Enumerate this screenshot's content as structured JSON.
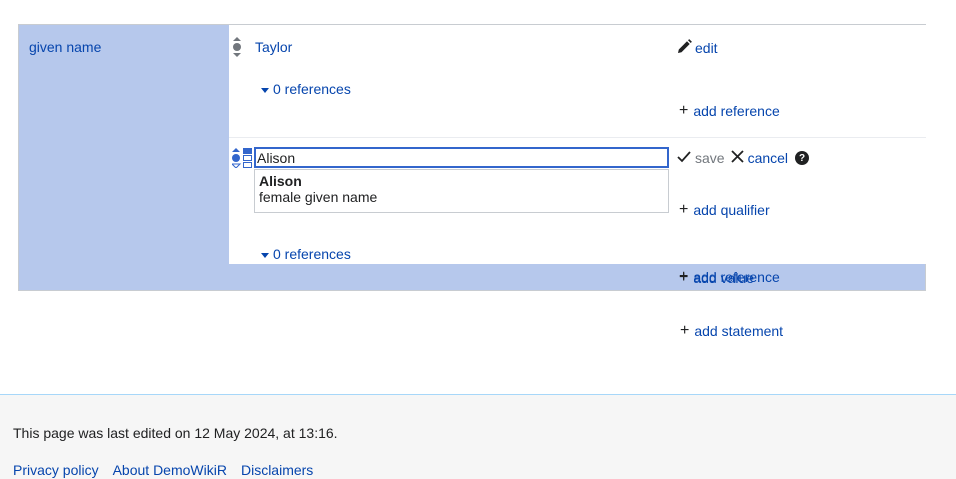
{
  "statement_group": {
    "property_label": "given name",
    "statements": [
      {
        "value": "Taylor",
        "edit_label": "edit",
        "references_label": "0 references",
        "add_reference_label": "add reference"
      }
    ],
    "editing": {
      "input_value": "Alison",
      "suggestion": {
        "label": "Alison",
        "description": "female given name"
      },
      "save_label": "save",
      "cancel_label": "cancel",
      "help_glyph": "?",
      "add_qualifier_label": "add qualifier",
      "references_label": "0 references",
      "add_reference_label": "add reference"
    },
    "add_value_label": "add value"
  },
  "add_statement_label": "add statement",
  "footer": {
    "last_edited": "This page was last edited on 12 May 2024, at 13:16.",
    "links": [
      "Privacy policy",
      "About DemoWikiR",
      "Disclaimers"
    ]
  },
  "icons": {
    "rank": "rank-selector-icon",
    "edit": "pencil-icon",
    "save": "checkmark-icon",
    "cancel": "close-icon",
    "add": "plus-icon",
    "help": "help-icon",
    "toggle": "triangle-down-icon",
    "snak_type": "snak-type-selector-icon"
  },
  "colors": {
    "group_bg": "#b6c8ec",
    "link": "#0645ad",
    "footer_bg": "#f6f6f6",
    "footer_border": "#a7d7f9"
  }
}
